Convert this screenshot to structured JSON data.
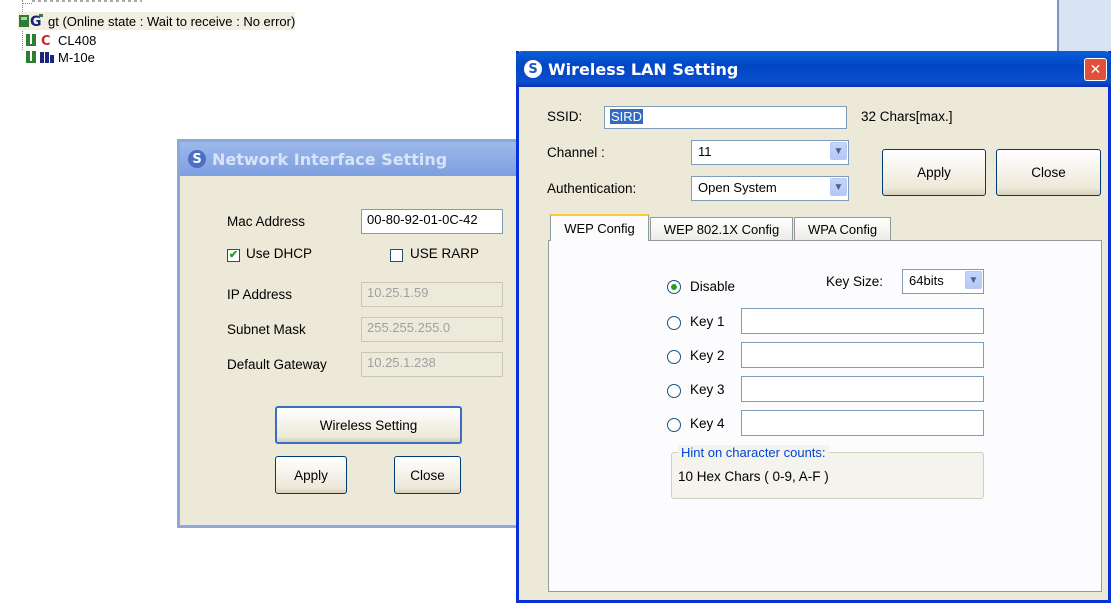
{
  "tree": {
    "items": [
      {
        "label": "gt (Online state : Wait to receive : No error)",
        "icon": "gt-device-icon"
      },
      {
        "label": "CL408",
        "icon": "cl-device-icon"
      },
      {
        "label": "M-10e",
        "icon": "m-device-icon"
      }
    ]
  },
  "network_dialog": {
    "title": "Network Interface Setting",
    "mac_label": "Mac Address",
    "mac_value": "00-80-92-01-0C-42",
    "use_dhcp_label": "Use DHCP",
    "use_dhcp_checked": true,
    "use_rarp_label": "USE RARP",
    "use_rarp_checked": false,
    "ip_label": "IP Address",
    "ip_value": "10.25.1.59",
    "subnet_label": "Subnet Mask",
    "subnet_value": "255.255.255.0",
    "gateway_label": "Default Gateway",
    "gateway_value": "10.25.1.238",
    "wireless_button": "Wireless Setting",
    "apply_button": "Apply",
    "close_button": "Close"
  },
  "wireless_dialog": {
    "title": "Wireless LAN Setting",
    "close_glyph": "✕",
    "ssid_label": "SSID:",
    "ssid_value": "SIRD",
    "ssid_hint": "32 Chars[max.]",
    "channel_label": "Channel :",
    "channel_value": "11",
    "auth_label": "Authentication:",
    "auth_value": "Open System",
    "apply_button": "Apply",
    "close_button": "Close",
    "tabs": [
      {
        "label": "WEP Config",
        "active": true
      },
      {
        "label": "WEP 802.1X Config",
        "active": false
      },
      {
        "label": "WPA Config",
        "active": false
      }
    ],
    "wep": {
      "disable_label": "Disable",
      "key_size_label": "Key Size:",
      "key_size_value": "64bits",
      "key1_label": "Key 1",
      "key2_label": "Key 2",
      "key3_label": "Key 3",
      "key4_label": "Key 4",
      "key1_value": "",
      "key2_value": "",
      "key3_value": "",
      "key4_value": "",
      "hint_title": "Hint on character counts:",
      "hint_text": "10 Hex Chars ( 0-9, A-F )"
    }
  },
  "colors": {
    "title_bar_start": "#0a246a",
    "title_bar_inactive_text": "#d8e4f8",
    "accent_green": "#21a121",
    "close_red": "#e0503a"
  }
}
